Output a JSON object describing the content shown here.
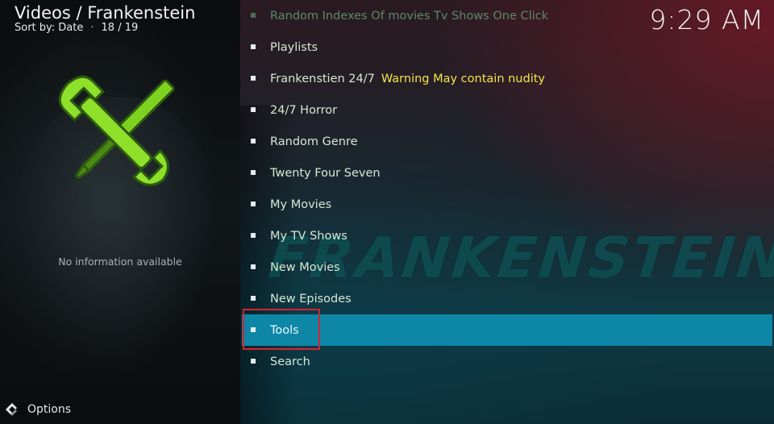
{
  "header": {
    "title": "Videos / Frankenstein",
    "sort_label": "Sort by: Date",
    "position": "18 / 19"
  },
  "clock": "9:29 AM",
  "info_panel": {
    "message": "No information available",
    "thumbnail_icon": "tools-icon"
  },
  "options": {
    "label": "Options",
    "icon": "options-icon"
  },
  "watermark": "FRANKENSTEIN",
  "colors": {
    "focus": "#0e86a6",
    "warning": "#f2e64a",
    "item_text": "#d5e8d2",
    "annotation_box": "#d3262e"
  },
  "menu": {
    "items": [
      {
        "label": "Random Indexes Of movies Tv Shows One Click",
        "warning": ""
      },
      {
        "label": "Playlists",
        "warning": ""
      },
      {
        "label": "Frankenstien 24/7",
        "warning": "Warning May contain nudity"
      },
      {
        "label": "24/7 Horror",
        "warning": ""
      },
      {
        "label": "Random Genre",
        "warning": ""
      },
      {
        "label": "Twenty Four Seven",
        "warning": ""
      },
      {
        "label": "My Movies",
        "warning": ""
      },
      {
        "label": "My TV Shows",
        "warning": ""
      },
      {
        "label": "New Movies",
        "warning": ""
      },
      {
        "label": "New Episodes",
        "warning": ""
      },
      {
        "label": "Tools",
        "warning": ""
      },
      {
        "label": "Search",
        "warning": ""
      }
    ],
    "focused_label": "Tools"
  }
}
